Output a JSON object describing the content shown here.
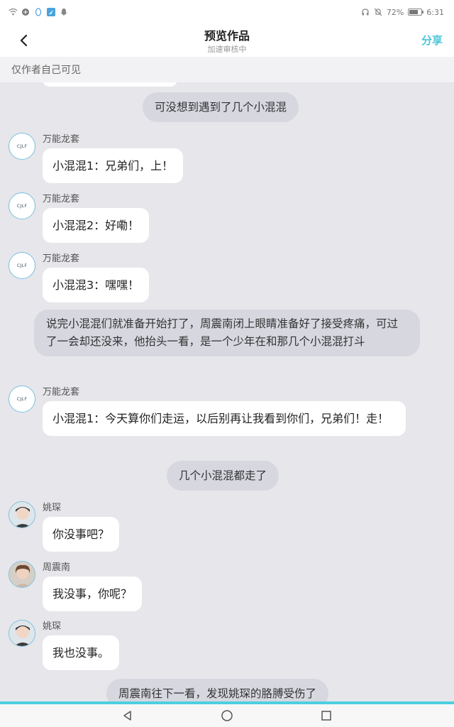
{
  "status_bar": {
    "battery_percent": "72%",
    "battery_level": 0.72,
    "time": "6:31",
    "left_icons": [
      "wifi-icon",
      "browser-icon",
      "qq-icon",
      "feishu-icon",
      "snapchat-icon"
    ],
    "right_icons": [
      "headphone-icon",
      "mute-icon",
      "battery-icon"
    ]
  },
  "header": {
    "title": "预览作品",
    "subtitle": "加速审核中",
    "share_label": "分享"
  },
  "banner": {
    "text": "仅作者自己可见"
  },
  "colors": {
    "accent": "#4cc6d8",
    "narration_bg": "#d6d7df",
    "bubble_bg": "#ffffff",
    "background": "#e6e6eb"
  },
  "avatars": {
    "logo_text": "CJLF"
  },
  "chat": {
    "n1": "可没想到遇到了几个小混混",
    "m1": {
      "name": "万能龙套",
      "text": "小混混1：兄弟们，上！"
    },
    "m2": {
      "name": "万能龙套",
      "text": "小混混2：好嘞！"
    },
    "m3": {
      "name": "万能龙套",
      "text": "小混混3：嘿嘿！"
    },
    "n2": "说完小混混们就准备开始打了，周震南闭上眼睛准备好了接受疼痛，可过了一会却还没来，他抬头一看，是一个少年在和那几个小混混打斗",
    "m4": {
      "name": "万能龙套",
      "text": "小混混1：今天算你们走运，以后别再让我看到你们，兄弟们！走！"
    },
    "n3": "几个小混混都走了",
    "m5": {
      "name": "姚琛",
      "text": "你没事吧？"
    },
    "m6": {
      "name": "周震南",
      "text": "我没事，你呢？"
    },
    "m7": {
      "name": "姚琛",
      "text": "我也没事。"
    },
    "n4": "周震南往下一看，发现姚琛的胳膊受伤了"
  },
  "system_nav": {
    "buttons": [
      "back-triangle-icon",
      "home-circle-icon",
      "recents-square-icon"
    ]
  }
}
